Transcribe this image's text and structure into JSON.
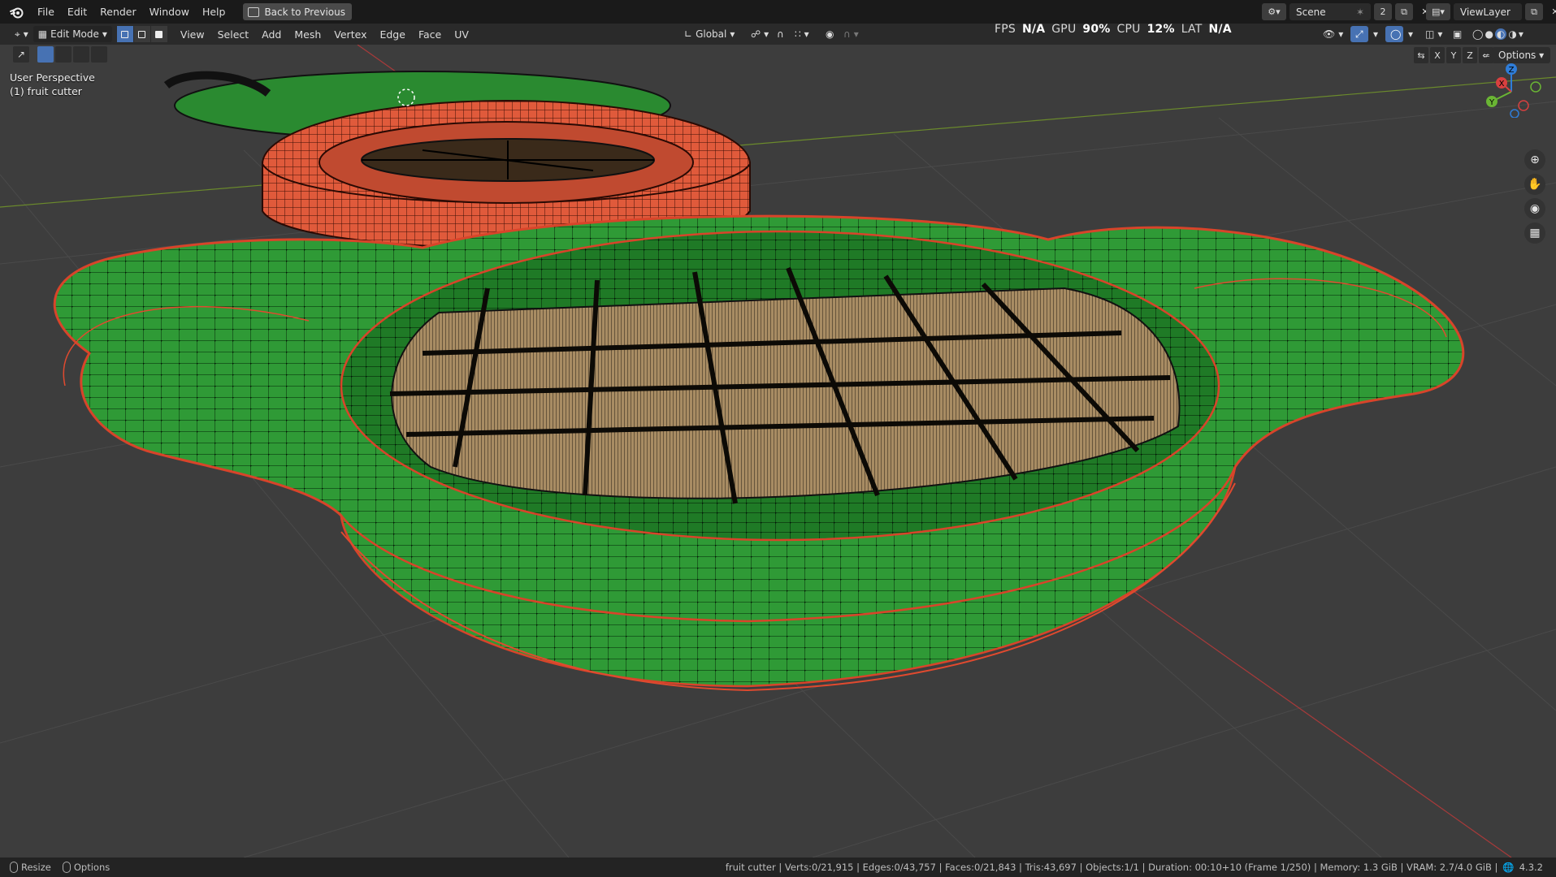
{
  "menubar": {
    "items": [
      "File",
      "Edit",
      "Render",
      "Window",
      "Help"
    ],
    "back_button": "Back to Previous",
    "scene_label": "Scene",
    "scene_count": "2",
    "viewlayer_label": "ViewLayer"
  },
  "viewport_header": {
    "mode": "Edit Mode",
    "menus": [
      "View",
      "Select",
      "Add",
      "Mesh",
      "Vertex",
      "Edge",
      "Face",
      "UV"
    ],
    "transform_orientation": "Global",
    "options_label": "Options",
    "axes": [
      "X",
      "Y",
      "Z"
    ]
  },
  "stats_overlay": {
    "fps_label": "FPS",
    "fps_value": "N/A",
    "gpu_label": "GPU",
    "gpu_value": "90%",
    "cpu_label": "CPU",
    "cpu_value": "12%",
    "lat_label": "LAT",
    "lat_value": "N/A"
  },
  "viewport": {
    "view_name": "User Perspective",
    "object_name": "(1) fruit cutter"
  },
  "gizmo": {
    "x": "X",
    "y": "Y",
    "z": "Z"
  },
  "statusbar": {
    "left_items": [
      "Resize",
      "Options"
    ],
    "info": "fruit cutter | Verts:0/21,915 | Edges:0/43,757 | Faces:0/21,843 | Tris:43,697 | Objects:1/1 | Duration: 00:10+10 (Frame 1/250) | Memory: 1.3 GiB | VRAM: 2.7/4.0 GiB |",
    "version": "4.3.2"
  },
  "colors": {
    "accent": "#4772b3",
    "mesh_green": "#3aa63f",
    "mesh_red": "#e0583a",
    "blade": "#a89068",
    "viewport_bg": "#3d3d3d"
  }
}
